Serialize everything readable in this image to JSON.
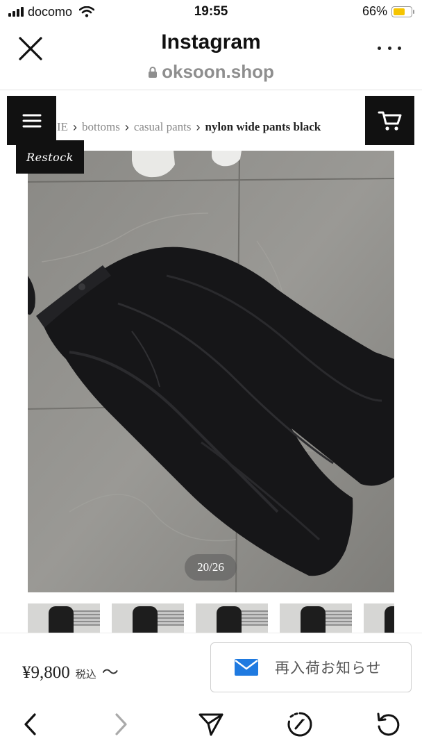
{
  "status_bar": {
    "carrier": "docomo",
    "time": "19:55",
    "battery": "66%",
    "battery_level": 0.66
  },
  "header": {
    "title": "Instagram",
    "url": "oksoon.shop"
  },
  "shop": {
    "breadcrumb": [
      "IE",
      "bottoms",
      "casual pants",
      "nylon wide pants black"
    ],
    "badge": "Restock",
    "image_counter": "20/26",
    "thumbnail_count": 5
  },
  "purchase": {
    "price": "¥9,800",
    "tax_note": "税込",
    "tilde": "〜",
    "notify_label": "再入荷お知らせ"
  },
  "colors": {
    "accent_blue": "#1f7ae0",
    "battery_yellow": "#f5c400",
    "dark_button": "#111111"
  },
  "icons": [
    "close-icon",
    "more-icon",
    "lock-icon",
    "menu-icon",
    "cart-icon",
    "mail-icon",
    "back-icon",
    "forward-icon",
    "share-icon",
    "compass-icon",
    "reload-icon"
  ]
}
